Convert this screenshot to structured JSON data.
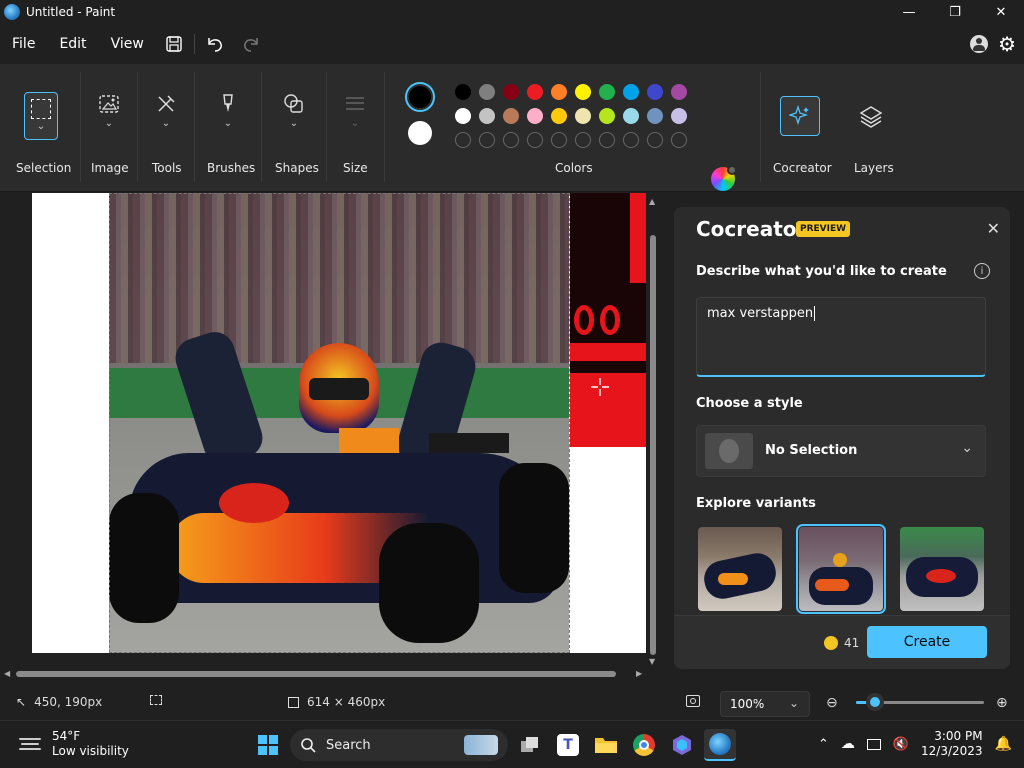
{
  "window": {
    "title": "Untitled - Paint",
    "minimize": "—",
    "maximize": "❐",
    "close": "✕"
  },
  "menu": {
    "file": "File",
    "edit": "Edit",
    "view": "View"
  },
  "ribbon": {
    "selection": "Selection",
    "image": "Image",
    "tools": "Tools",
    "brushes": "Brushes",
    "shapes": "Shapes",
    "size": "Size",
    "colors": "Colors",
    "cocreator": "Cocreator",
    "layers": "Layers"
  },
  "palette": {
    "row1": [
      "#000000",
      "#7f7f7f",
      "#880015",
      "#ed1c24",
      "#ff7f27",
      "#fff200",
      "#22b14c",
      "#00a2e8",
      "#3f48cc",
      "#a349a4"
    ],
    "row2": [
      "#ffffff",
      "#c3c3c3",
      "#b97a57",
      "#ffaec9",
      "#ffc90e",
      "#efe4b0",
      "#b5e61d",
      "#99d9ea",
      "#7092be",
      "#c8bfe7"
    ],
    "primary": "#000000",
    "secondary": "#ffffff",
    "accent": "#4cc2ff"
  },
  "cocreator": {
    "title": "Cocreator",
    "badge": "PREVIEW",
    "describe_label": "Describe what you'd like to create",
    "prompt_value": "max verstappen",
    "style_label": "Choose a style",
    "style_value": "No Selection",
    "variants_label": "Explore variants",
    "credits": "41",
    "create_label": "Create"
  },
  "status": {
    "cursor_pos": "450, 190px",
    "canvas_size": "614 × 460px",
    "zoom": "100%"
  },
  "taskbar": {
    "temperature": "54°F",
    "weather_desc": "Low visibility",
    "search": "Search",
    "time": "3:00 PM",
    "date": "12/3/2023"
  }
}
